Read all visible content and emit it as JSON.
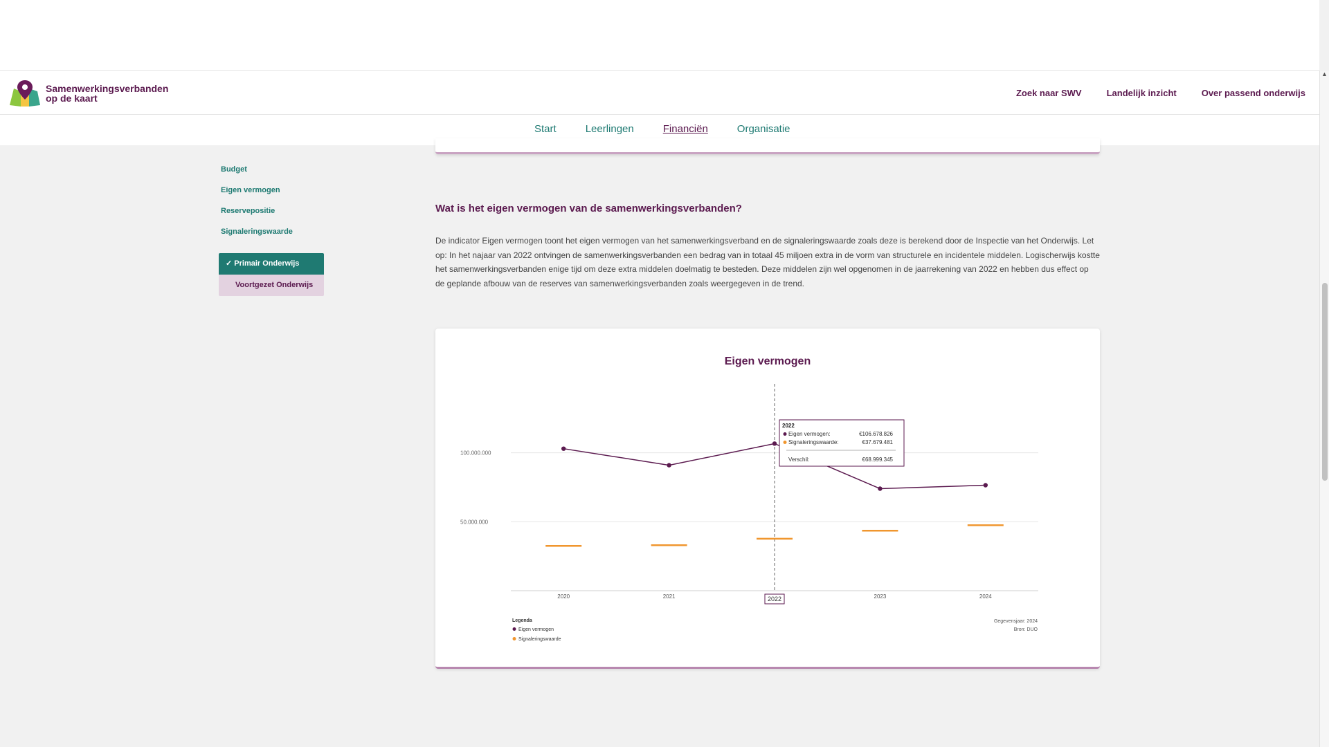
{
  "brand": {
    "line1": "Samenwerkingsverbanden",
    "line2": "op de kaart"
  },
  "topnav": [
    "Zoek naar SWV",
    "Landelijk inzicht",
    "Over passend onderwijs"
  ],
  "subnav": {
    "items": [
      "Start",
      "Leerlingen",
      "Financiën",
      "Organisatie"
    ],
    "active": "Financiën"
  },
  "sidenav": {
    "items": [
      "Budget",
      "Eigen vermogen",
      "Reservepositie",
      "Signaleringswaarde"
    ],
    "segment": {
      "selected": "Primair Onderwijs",
      "other": "Voortgezet Onderwijs",
      "check": "✓"
    }
  },
  "section": {
    "heading": "Wat is het eigen vermogen van de samenwerkingsverbanden?",
    "body": "De indicator Eigen vermogen toont het eigen vermogen van het samenwerkingsverband en de signaleringswaarde zoals deze is berekend door de Inspectie van het Onderwijs. Let op: In het najaar van 2022 ontvingen de samenwerkingsverbanden een bedrag van in totaal 45 miljoen extra in de vorm van structurele en incidentele middelen. Logischerwijs kostte het samenwerkingsverbanden enige tijd om deze extra middelen doelmatig te besteden. Deze middelen zijn wel opgenomen in de jaarrekening van 2022 en hebben dus effect op de geplande afbouw van de reserves van samenwerkingsverbanden zoals weergegeven in de trend."
  },
  "chart_data": {
    "type": "line",
    "title": "Eigen vermogen",
    "categories": [
      "2020",
      "2021",
      "2022",
      "2023",
      "2024"
    ],
    "series": [
      {
        "name": "Eigen vermogen",
        "type": "line",
        "color": "#5b1a4f",
        "values": [
          103000000,
          91000000,
          106678826,
          74000000,
          76500000
        ]
      },
      {
        "name": "Signaleringswaarde",
        "type": "marker",
        "color": "#f0962e",
        "values": [
          32500000,
          33000000,
          37679481,
          43500000,
          47500000
        ]
      }
    ],
    "ylim": [
      0,
      150000000
    ],
    "yticks": [
      {
        "v": 50000000,
        "label": "50.000.000"
      },
      {
        "v": 100000000,
        "label": "100.000.000"
      }
    ],
    "grid": true,
    "legend_title": "Legenda",
    "legend_position": "bottom-left",
    "footer": [
      "Gegevensjaar: 2024",
      "Bron: DUO"
    ],
    "tooltip": {
      "category": "2022",
      "rows": [
        {
          "label": "Eigen vermogen:",
          "value": "€106.678.826",
          "color": "#5b1a4f"
        },
        {
          "label": "Signaleringswaarde:",
          "value": "€37.679.481",
          "color": "#f0962e"
        }
      ],
      "diff_label": "Verschil:",
      "diff_value": "€68.999.345"
    }
  }
}
